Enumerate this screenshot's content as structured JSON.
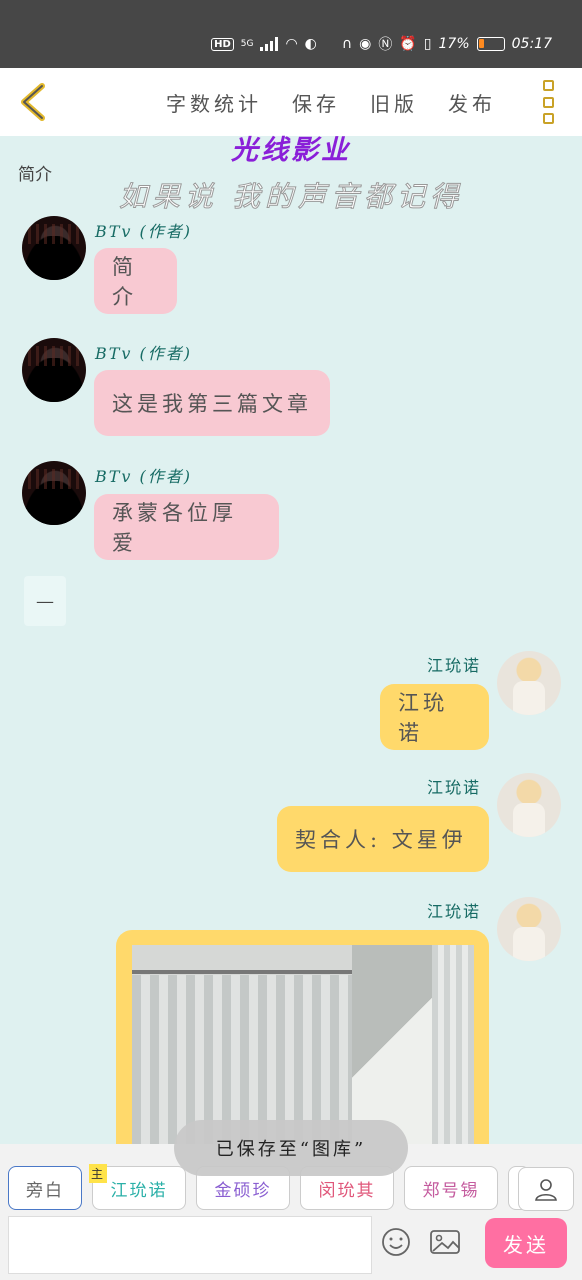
{
  "status": {
    "hd": "HD",
    "network": "5G",
    "battery": "17%",
    "time": "05:17"
  },
  "header": {
    "menu": [
      "字数统计",
      "保存",
      "旧版",
      "发布"
    ]
  },
  "brand": "光线影业",
  "subtitle": "如果说 我的声音都记得",
  "intro_label": "简介",
  "messages": [
    {
      "author": "BTv (作者)",
      "text": "简介"
    },
    {
      "author": "BTv (作者)",
      "text": "这是我第三篇文章"
    },
    {
      "author": "BTv (作者)",
      "text": "承蒙各位厚爱"
    },
    {
      "author": "江玧诺",
      "text": "江玧诺"
    },
    {
      "author": "江玧诺",
      "text": "契合人: 文星伊"
    },
    {
      "author": "江玧诺",
      "text": ""
    }
  ],
  "divider_label": "—",
  "toast": "已保存至“图库”",
  "roles": [
    {
      "label": "旁白",
      "color": "#666666"
    },
    {
      "label": "江玧诺",
      "color": "#2bb0a8",
      "badge": "主"
    },
    {
      "label": "金硕珍",
      "color": "#8a5fd1"
    },
    {
      "label": "闵玧其",
      "color": "#e0577a"
    },
    {
      "label": "郑号锡",
      "color": "#c45b9e"
    }
  ],
  "send_label": "发送",
  "colors": {
    "background": "#dff1f0",
    "pink_bubble": "#f8c9d2",
    "yellow_bubble": "#ffd96b",
    "send_button": "#ff6fa2",
    "brand": "#8a1fd8"
  }
}
